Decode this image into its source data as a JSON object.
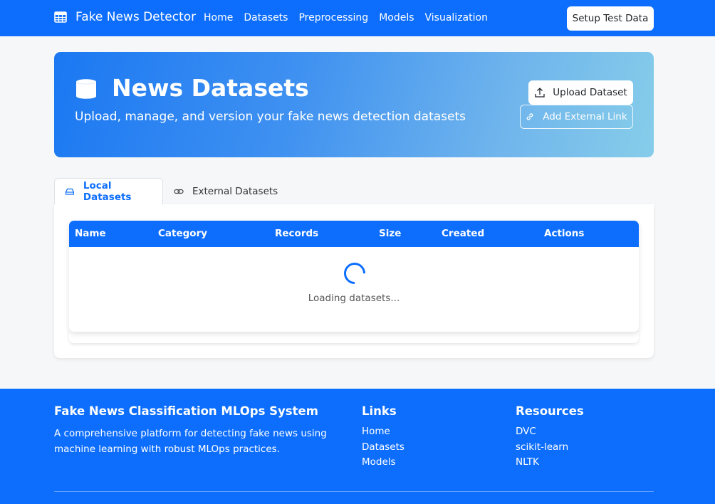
{
  "navbar": {
    "brand": "Fake News Detector",
    "links": [
      "Home",
      "Datasets",
      "Preprocessing",
      "Models",
      "Visualization"
    ],
    "setup_button": "Setup Test Data"
  },
  "hero": {
    "title": "News Datasets",
    "subtitle": "Upload, manage, and version your fake news detection datasets",
    "upload_button": "Upload Dataset",
    "external_button": "Add External Link"
  },
  "tabs": {
    "local": "Local Datasets",
    "external": "External Datasets"
  },
  "table": {
    "columns": [
      "Name",
      "Category",
      "Records",
      "Size",
      "Created",
      "Actions"
    ],
    "loading_text": "Loading datasets..."
  },
  "footer": {
    "about_title": "Fake News Classification MLOps System",
    "about_text": "A comprehensive platform for detecting fake news using machine learning with robust MLOps practices.",
    "links_title": "Links",
    "links": [
      "Home",
      "Datasets",
      "Models"
    ],
    "resources_title": "Resources",
    "resources": [
      "DVC",
      "scikit-learn",
      "NLTK"
    ]
  },
  "colors": {
    "primary": "#0d6efd",
    "background": "#f6f7f9"
  },
  "icons": {
    "brand": "table-icon",
    "hero": "database-icon",
    "upload": "upload-icon",
    "external": "link-icon",
    "local_tab": "hdd-icon",
    "external_tab": "link-icon",
    "loading": "spinner-icon"
  }
}
